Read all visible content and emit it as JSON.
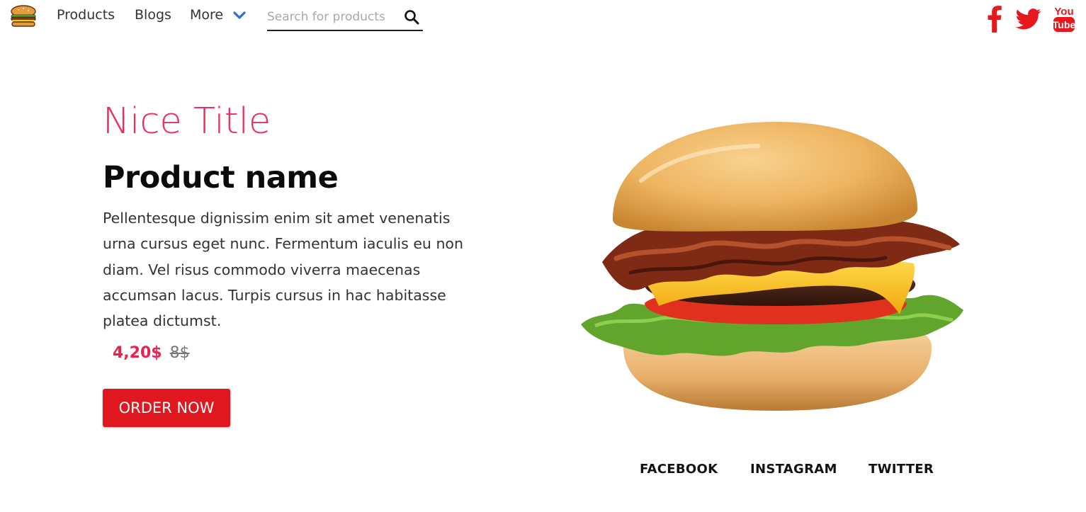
{
  "nav": {
    "logo_icon": "burger-logo-icon",
    "links": [
      "Products",
      "Blogs",
      "More"
    ],
    "more_icon": "chevron-down-icon",
    "search": {
      "placeholder": "Search for products",
      "value": "",
      "icon": "search-icon"
    },
    "social_icons": [
      "facebook-icon",
      "twitter-icon",
      "youtube-icon"
    ],
    "youtube_text": [
      "You",
      "Tube"
    ]
  },
  "hero": {
    "title": "Nice Title",
    "product_name": "Product name",
    "description": "Pellentesque dignissim enim sit amet venenatis urna cursus eget nunc. Fermentum iaculis eu non diam. Vel risus commodo viverra maecenas accumsan lacus. Turpis cursus in hac habitasse platea dictumst.",
    "price_new": "4,20$",
    "price_old": "8$",
    "cta_label": "ORDER NOW",
    "image": "burger-image"
  },
  "footer": {
    "links": [
      "FACEBOOK",
      "INSTAGRAM",
      "TWITTER"
    ]
  },
  "colors": {
    "accent_pink": "#ef2d5e",
    "price_red": "#e8234e",
    "button_red": "#e1171f",
    "social_red": "#e8161d"
  }
}
